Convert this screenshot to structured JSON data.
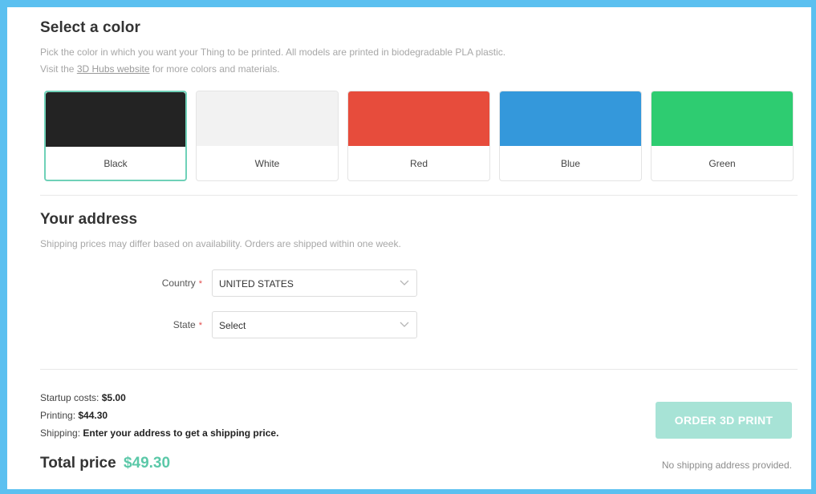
{
  "color_section": {
    "title": "Select a color",
    "desc_line1": "Pick the color in which you want your Thing to be printed. All models are printed in biodegradable PLA plastic.",
    "desc_visit": "Visit the",
    "desc_link": "3D Hubs website",
    "desc_rest": "for more colors and materials.",
    "swatches": [
      {
        "label": "Black",
        "color": "#232323",
        "selected": true
      },
      {
        "label": "White",
        "color": "#f2f2f2",
        "selected": false
      },
      {
        "label": "Red",
        "color": "#e74c3c",
        "selected": false
      },
      {
        "label": "Blue",
        "color": "#3498db",
        "selected": false
      },
      {
        "label": "Green",
        "color": "#2ecc71",
        "selected": false
      }
    ]
  },
  "address_section": {
    "title": "Your address",
    "desc": "Shipping prices may differ based on availability. Orders are shipped within one week.",
    "country_label": "Country",
    "country_value": "UNITED STATES",
    "state_label": "State",
    "state_value": "Select",
    "required_mark": "*"
  },
  "summary": {
    "startup_label": "Startup costs:",
    "startup_value": "$5.00",
    "printing_label": "Printing:",
    "printing_value": "$44.30",
    "shipping_label": "Shipping:",
    "shipping_value": "Enter your address to get a shipping price.",
    "total_label": "Total price",
    "total_value": "$49.30",
    "order_button": "ORDER 3D PRINT",
    "note": "No shipping address provided."
  },
  "colors": {
    "accent": "#5bc8a8",
    "button_disabled": "#a7e3d6",
    "frame": "#5bc0f0"
  }
}
